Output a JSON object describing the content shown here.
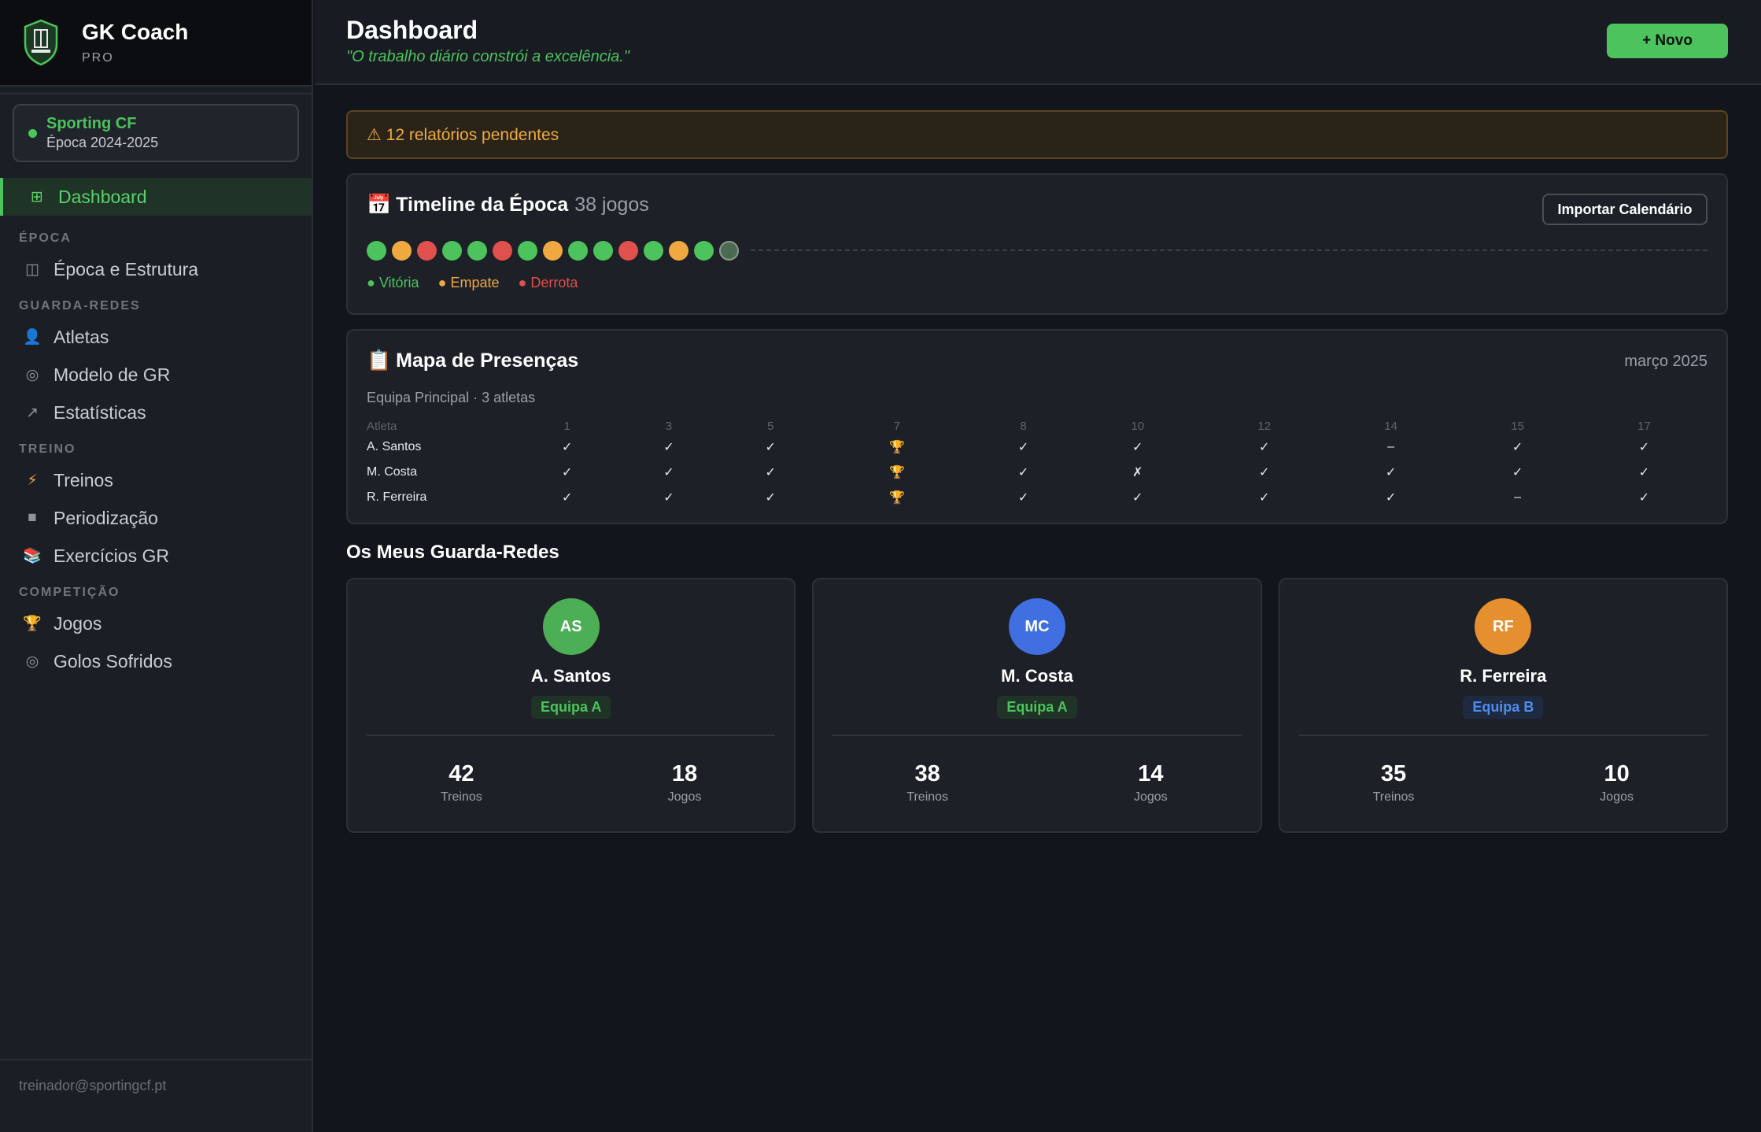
{
  "sidebar": {
    "brand_name": "GK Coach",
    "brand_tier": "PRO",
    "club": {
      "name": "Sporting CF",
      "season": "Época 2024-2025"
    },
    "active_item": {
      "label": "Dashboard",
      "icon": "grid-icon"
    },
    "sections": [
      {
        "title": "ÉPOCA",
        "items": [
          {
            "label": "Época e Estrutura",
            "icon": "columns-icon"
          }
        ]
      },
      {
        "title": "GUARDA-REDES",
        "items": [
          {
            "label": "Atletas",
            "icon": "person-icon"
          },
          {
            "label": "Modelo de GR",
            "icon": "target-icon"
          },
          {
            "label": "Estatísticas",
            "icon": "trend-arrow-icon"
          }
        ]
      },
      {
        "title": "TREINO",
        "items": [
          {
            "label": "Treinos",
            "icon": "lightning-icon"
          },
          {
            "label": "Periodização",
            "icon": "square-icon"
          },
          {
            "label": "Exercícios GR",
            "icon": "books-icon"
          }
        ]
      },
      {
        "title": "COMPETIÇÃO",
        "items": [
          {
            "label": "Jogos",
            "icon": "trophy-icon"
          },
          {
            "label": "Golos Sofridos",
            "icon": "target-icon"
          }
        ]
      }
    ],
    "footer_email": "treinador@sportingcf.pt"
  },
  "header": {
    "title": "Dashboard",
    "quote": "\"O trabalho diário constrói a excelência.\"",
    "new_button": "+ Novo"
  },
  "alert": {
    "text": "⚠ 12 relatórios pendentes"
  },
  "timeline": {
    "icon": "📅",
    "title": "Timeline da Época",
    "count": "38 jogos",
    "import_button": "Importar Calendário",
    "results": [
      "win",
      "draw",
      "loss",
      "win",
      "win",
      "loss",
      "win",
      "draw",
      "win",
      "win",
      "loss",
      "win",
      "draw",
      "win",
      "next"
    ],
    "legend": {
      "win": "● Vitória",
      "draw": "● Empate",
      "loss": "● Derrota"
    }
  },
  "attendance": {
    "icon": "📋",
    "title": "Mapa de Presenças",
    "month": "março 2025",
    "subtitle": "Equipa Principal · 3 atletas",
    "columns": [
      "Atleta",
      "1",
      "3",
      "5",
      "7",
      "8",
      "10",
      "12",
      "14",
      "15",
      "17"
    ],
    "rows": [
      {
        "name": "A. Santos",
        "cells": [
          "✓",
          "✓",
          "✓",
          "🏆",
          "✓",
          "✓",
          "✓",
          "–",
          "✓",
          "✓"
        ]
      },
      {
        "name": "M. Costa",
        "cells": [
          "✓",
          "✓",
          "✓",
          "🏆",
          "✓",
          "✗",
          "✓",
          "✓",
          "✓",
          "✓"
        ]
      },
      {
        "name": "R. Ferreira",
        "cells": [
          "✓",
          "✓",
          "✓",
          "🏆",
          "✓",
          "✓",
          "✓",
          "✓",
          "–",
          "✓"
        ]
      }
    ]
  },
  "goalkeepers": {
    "section_title": "Os Meus Guarda-Redes",
    "items": [
      {
        "initials": "AS",
        "name": "A. Santos",
        "team": "Equipa A",
        "avatar_color": "#4cae55",
        "team_color": "#4cc35c",
        "team_bg": "#1f3326",
        "treinos": "42",
        "jogos": "18",
        "treinos_label": "Treinos",
        "jogos_label": "Jogos"
      },
      {
        "initials": "MC",
        "name": "M. Costa",
        "team": "Equipa A",
        "avatar_color": "#3f6fe0",
        "team_color": "#4cc35c",
        "team_bg": "#1f3326",
        "treinos": "38",
        "jogos": "14",
        "treinos_label": "Treinos",
        "jogos_label": "Jogos"
      },
      {
        "initials": "RF",
        "name": "R. Ferreira",
        "team": "Equipa B",
        "avatar_color": "#e58f2e",
        "team_color": "#4f8df0",
        "team_bg": "#1e2a40",
        "treinos": "35",
        "jogos": "10",
        "treinos_label": "Treinos",
        "jogos_label": "Jogos"
      }
    ]
  }
}
